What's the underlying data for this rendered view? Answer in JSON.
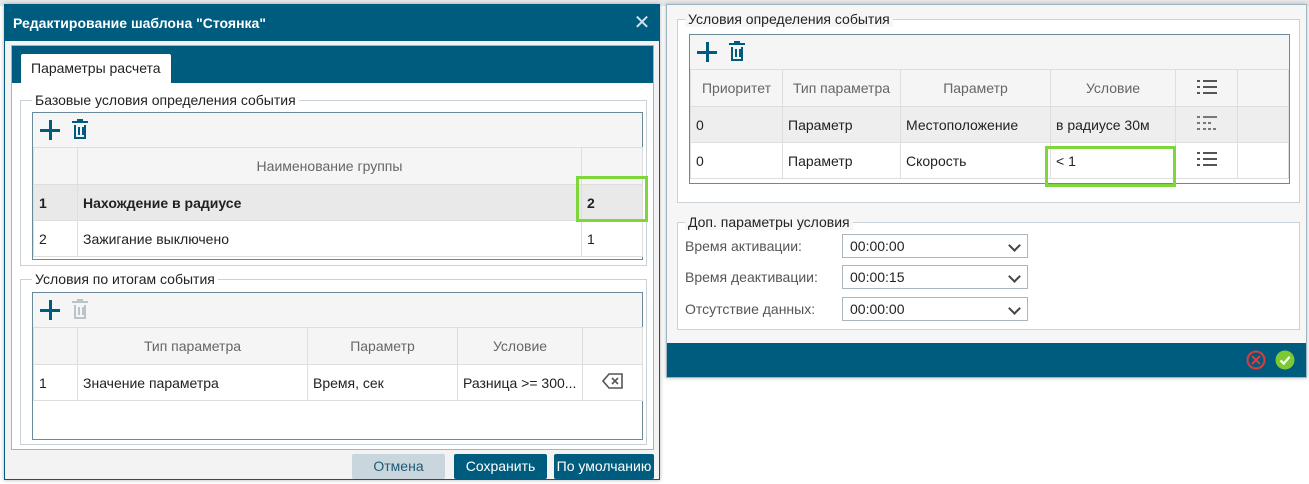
{
  "left_dialog": {
    "title": "Редактирование шаблона \"Стоянка\"",
    "tab": "Параметры расчета",
    "base_group": {
      "title": "Базовые условия определения события",
      "header": "Наименование группы",
      "rows": [
        {
          "num": "1",
          "name": "Нахождение в радиусе",
          "count": "2"
        },
        {
          "num": "2",
          "name": "Зажигание выключено",
          "count": "1"
        }
      ]
    },
    "result_group": {
      "title": "Условия по итогам события",
      "headers": [
        "Тип параметра",
        "Параметр",
        "Условие"
      ],
      "rows": [
        {
          "num": "1",
          "type": "Значение параметра",
          "param": "Время, сек",
          "cond": "Разница >= 300..."
        }
      ]
    },
    "buttons": {
      "cancel": "Отмена",
      "save": "Сохранить",
      "default": "По умолчанию"
    }
  },
  "right_panel": {
    "conditions": {
      "title": "Условия определения события",
      "headers": [
        "Приоритет",
        "Тип параметра",
        "Параметр",
        "Условие"
      ],
      "rows": [
        {
          "priority": "0",
          "type": "Параметр",
          "param": "Местоположение",
          "cond": "в радиусе 30м"
        },
        {
          "priority": "0",
          "type": "Параметр",
          "param": "Скорость",
          "cond": "< 1"
        }
      ]
    },
    "extra": {
      "title": "Доп. параметры условия",
      "fields": [
        {
          "label": "Время активации:",
          "value": "00:00:00"
        },
        {
          "label": "Время деактивации:",
          "value": "00:00:15"
        },
        {
          "label": "Отсутствие данных:",
          "value": "00:00:00"
        }
      ]
    }
  },
  "colors": {
    "accent": "#005c7f",
    "highlight": "#7fd63a",
    "cancel_icon": "#e03a3a",
    "confirm_icon": "#7cc934"
  }
}
